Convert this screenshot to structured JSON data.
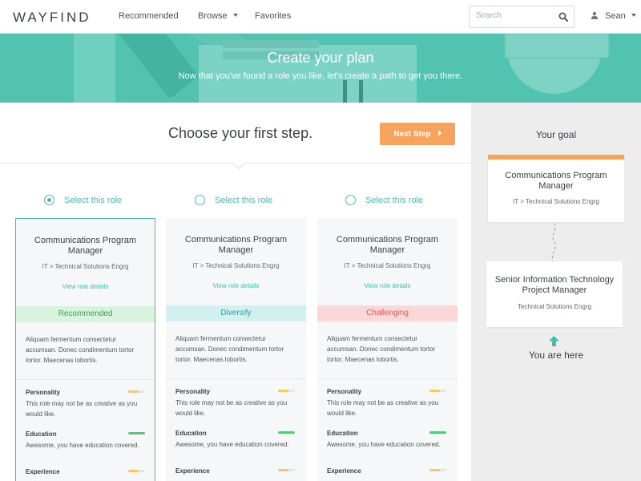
{
  "brand": {
    "logo_part1": "WAY",
    "logo_part2": "FIND"
  },
  "nav": {
    "links": [
      {
        "label": "Recommended"
      },
      {
        "label": "Browse"
      },
      {
        "label": "Favorites"
      }
    ],
    "search_placeholder": "Search",
    "user_name": "Sean"
  },
  "hero": {
    "title": "Create your plan",
    "subtitle": "Now that you've found a role you like, let's create a path to get you there."
  },
  "steps": {
    "title": "Choose your first step.",
    "next_label": "Next Step",
    "select_label": "Select this role"
  },
  "cards": [
    {
      "selected": true,
      "title": "Communications Program Manager",
      "path": "IT > Technical Solutions Engrg",
      "link": "View role details",
      "tag": "Recommended",
      "tag_bg": "#d9f4de",
      "tag_color": "#3c9b52",
      "description": "Aliquam fermentum consectetur accumsan. Donec condimentum tortor tortor. Maecenas lobortis.",
      "metrics": [
        {
          "label": "Personality",
          "text": "This role may not be as creative as you would like.",
          "level": 0.6,
          "color": "#f8c85a"
        },
        {
          "label": "Education",
          "text": "Awesome, you have education covered.",
          "level": 1.0,
          "color": "#55c978"
        },
        {
          "label": "Experience",
          "text": "",
          "level": 0.6,
          "color": "#f8c85a"
        }
      ]
    },
    {
      "selected": false,
      "title": "Communications Program Manager",
      "path": "IT > Technical Solutions Engrg",
      "link": "View role details",
      "tag": "Diversify",
      "tag_bg": "#d2f0f0",
      "tag_color": "#2e9c9b",
      "description": "Aliquam fermentum consectetur accumsan. Donec condimentum tortor tortor. Maecenas lobortis.",
      "metrics": [
        {
          "label": "Personality",
          "text": "This role may not be as creative as you would like.",
          "level": 0.6,
          "color": "#f8c85a"
        },
        {
          "label": "Education",
          "text": "Awesome, you have education covered.",
          "level": 1.0,
          "color": "#55c978"
        },
        {
          "label": "Experience",
          "text": "",
          "level": 0.6,
          "color": "#f8c85a"
        }
      ]
    },
    {
      "selected": false,
      "title": "Communications Program Manager",
      "path": "IT > Technical Solutions Engrg",
      "link": "View role details",
      "tag": "Challenging",
      "tag_bg": "#fbd7d7",
      "tag_color": "#d65a5a",
      "description": "Aliquam fermentum consectetur accumsan. Donec condimentum tortor tortor. Maecenas lobortis.",
      "metrics": [
        {
          "label": "Personality",
          "text": "This role may not be as creative as you would like.",
          "level": 0.6,
          "color": "#f8c85a"
        },
        {
          "label": "Education",
          "text": "Awesome, you have education covered.",
          "level": 1.0,
          "color": "#55c978"
        },
        {
          "label": "Experience",
          "text": "",
          "level": 0.6,
          "color": "#f8c85a"
        }
      ]
    }
  ],
  "sidebar": {
    "goal_title": "Your goal",
    "goal_role": "Communications Program Manager",
    "goal_path": "IT > Technical Solutions Engrg",
    "current_role": "Senior Information Technology Project Manager",
    "current_path": "Technical Solutions Engrg",
    "here_label": "You are here"
  },
  "colors": {
    "accent": "#3fbfae",
    "hero": "#52c3b0",
    "cta": "#f7a35c",
    "sidebar_bg": "#ededed"
  },
  "icons": {
    "search": "search-icon",
    "user": "user-icon",
    "caret": "chevron-down-icon",
    "arrow": "chevron-right-icon",
    "up": "arrow-up-icon"
  }
}
